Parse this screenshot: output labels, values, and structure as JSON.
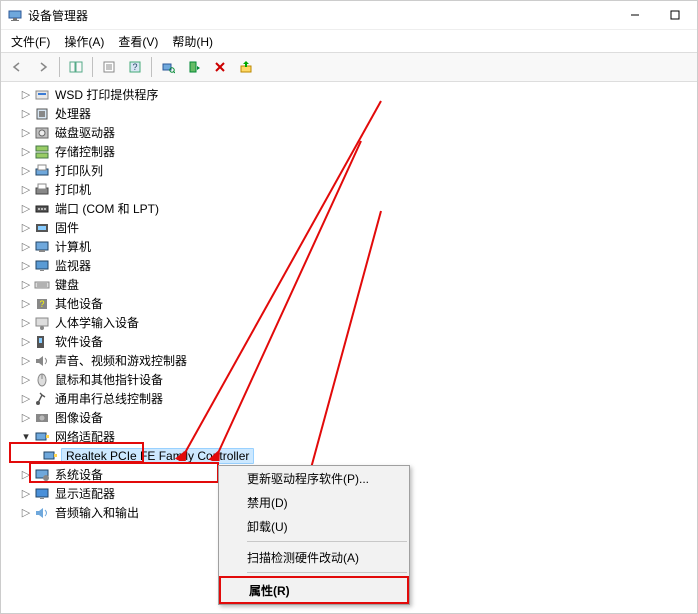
{
  "titlebar": {
    "title": "设备管理器"
  },
  "menu": {
    "file": "文件(F)",
    "action": "操作(A)",
    "view": "查看(V)",
    "help": "帮助(H)"
  },
  "tree": {
    "items": [
      {
        "label": "WSD 打印提供程序",
        "icon": "wsd"
      },
      {
        "label": "处理器",
        "icon": "cpu"
      },
      {
        "label": "磁盘驱动器",
        "icon": "disk"
      },
      {
        "label": "存储控制器",
        "icon": "storage"
      },
      {
        "label": "打印队列",
        "icon": "printqueue"
      },
      {
        "label": "打印机",
        "icon": "printer"
      },
      {
        "label": "端口 (COM 和 LPT)",
        "icon": "port"
      },
      {
        "label": "固件",
        "icon": "firmware"
      },
      {
        "label": "计算机",
        "icon": "computer"
      },
      {
        "label": "监视器",
        "icon": "monitor"
      },
      {
        "label": "键盘",
        "icon": "keyboard"
      },
      {
        "label": "其他设备",
        "icon": "other"
      },
      {
        "label": "人体学输入设备",
        "icon": "hid"
      },
      {
        "label": "软件设备",
        "icon": "soft"
      },
      {
        "label": "声音、视频和游戏控制器",
        "icon": "sound"
      },
      {
        "label": "鼠标和其他指针设备",
        "icon": "mouse"
      },
      {
        "label": "通用串行总线控制器",
        "icon": "usb"
      },
      {
        "label": "图像设备",
        "icon": "image"
      }
    ],
    "network": {
      "label": "网络适配器",
      "child": "Realtek PCIe FE Family Controller"
    },
    "tail": [
      {
        "label": "系统设备",
        "icon": "system"
      },
      {
        "label": "显示适配器",
        "icon": "display"
      },
      {
        "label": "音频输入和输出",
        "icon": "audio"
      }
    ]
  },
  "ctx": {
    "update": "更新驱动程序软件(P)...",
    "disable": "禁用(D)",
    "uninstall": "卸载(U)",
    "scan": "扫描检测硬件改动(A)",
    "properties": "属性(R)"
  }
}
